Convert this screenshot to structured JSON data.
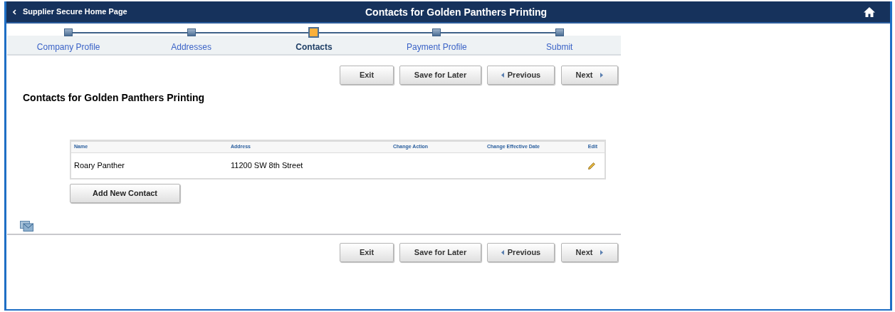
{
  "header": {
    "back_link": "Supplier Secure Home Page",
    "title": "Contacts for Golden Panthers Printing"
  },
  "steps": [
    {
      "label": "Company Profile",
      "selected": false
    },
    {
      "label": "Addresses",
      "selected": false
    },
    {
      "label": "Contacts",
      "selected": true
    },
    {
      "label": "Payment Profile",
      "selected": false
    },
    {
      "label": "Submit",
      "selected": false
    }
  ],
  "top_buttons": [
    {
      "label": "Exit",
      "kind": "plain"
    },
    {
      "label": "Save for Later",
      "kind": "plain"
    },
    {
      "label": "Previous",
      "kind": "previous"
    },
    {
      "label": "Next",
      "kind": "next"
    }
  ],
  "page_title": "Contacts for Golden Panthers Printing",
  "table": {
    "columns": [
      "Name",
      "Address",
      "Change Action",
      "Change Effective Date",
      "Edit"
    ],
    "rows": [
      {
        "name": "Roary Panther",
        "address": "11200 SW 8th Street"
      }
    ]
  },
  "add_button": "Add New Contact",
  "bottom_buttons": [
    {
      "label": "Exit",
      "kind": "plain"
    },
    {
      "label": "Save for Later",
      "kind": "plain"
    },
    {
      "label": "Previous",
      "kind": "previous"
    },
    {
      "label": "Next",
      "kind": "next"
    }
  ]
}
